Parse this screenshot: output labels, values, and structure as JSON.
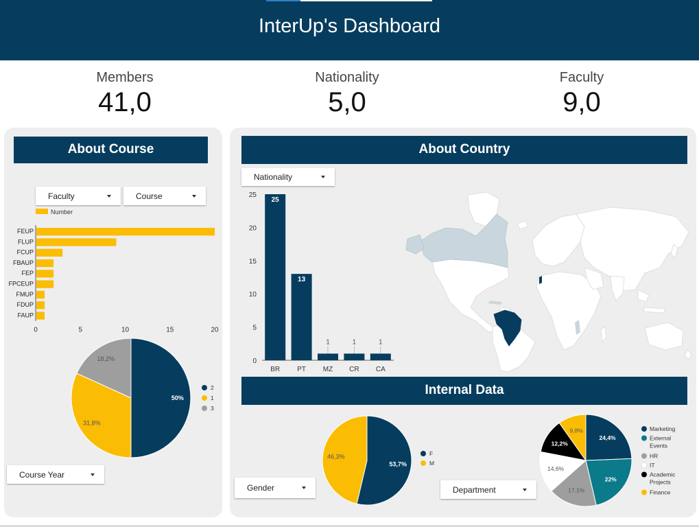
{
  "header": {
    "title": "InterUp's Dashboard"
  },
  "kpis": [
    {
      "label": "Members",
      "value": "41,0"
    },
    {
      "label": "Nationality",
      "value": "5,0"
    },
    {
      "label": "Faculty",
      "value": "9,0"
    }
  ],
  "course_panel": {
    "title": "About Course",
    "filters": {
      "faculty": "Faculty",
      "course": "Course",
      "course_year": "Course Year"
    }
  },
  "country_panel": {
    "title": "About Country",
    "filters": {
      "nationality": "Nationality"
    }
  },
  "internal_panel": {
    "title": "Internal Data",
    "filters": {
      "gender": "Gender",
      "department": "Department"
    }
  },
  "colors": {
    "navy": "#063d5e",
    "yellow": "#fbbc04",
    "teal": "#0b7a8a",
    "gray": "#9e9e9e",
    "black": "#000000",
    "white": "#ffffff",
    "map_highlight": "#063d5e",
    "map_light": "#c9d6de"
  },
  "chart_data": [
    {
      "id": "faculty_bar",
      "type": "bar",
      "orientation": "horizontal",
      "categories": [
        "FEUP",
        "FLUP",
        "FCUP",
        "FBAUP",
        "FEP",
        "FPCEUP",
        "FMUP",
        "FDUP",
        "FAUP"
      ],
      "series": [
        {
          "name": "Number",
          "values": [
            20,
            9,
            3,
            2,
            2,
            2,
            1,
            1,
            1
          ],
          "color": "#fbbc04"
        }
      ],
      "xlim": [
        0,
        20
      ],
      "xticks": [
        0,
        5,
        10,
        15,
        20
      ],
      "legend": "top-left"
    },
    {
      "id": "course_year_pie",
      "type": "pie",
      "slices": [
        {
          "label": "2",
          "value": 50,
          "text": "50%",
          "color": "#063d5e"
        },
        {
          "label": "1",
          "value": 31.8,
          "text": "31,8%",
          "color": "#fbbc04"
        },
        {
          "label": "3",
          "value": 18.2,
          "text": "18,2%",
          "color": "#9e9e9e"
        }
      ],
      "legend": "right"
    },
    {
      "id": "nationality_bar",
      "type": "bar",
      "categories": [
        "BR",
        "PT",
        "MZ",
        "CR",
        "CA"
      ],
      "series": [
        {
          "values": [
            25,
            13,
            1,
            1,
            1
          ],
          "color": "#063d5e"
        }
      ],
      "ylim": [
        0,
        25
      ],
      "yticks": [
        0,
        5,
        10,
        15,
        20,
        25
      ],
      "data_labels": true
    },
    {
      "id": "gender_pie",
      "type": "pie",
      "slices": [
        {
          "label": "F",
          "value": 53.7,
          "text": "53,7%",
          "color": "#063d5e"
        },
        {
          "label": "M",
          "value": 46.3,
          "text": "46,3%",
          "color": "#fbbc04"
        }
      ],
      "legend": "right"
    },
    {
      "id": "department_pie",
      "type": "pie",
      "slices": [
        {
          "label": "Marketing",
          "value": 24.4,
          "text": "24,4%",
          "color": "#063d5e"
        },
        {
          "label": "External Events",
          "value": 22,
          "text": "22%",
          "color": "#0b7a8a"
        },
        {
          "label": "HR",
          "value": 17.1,
          "text": "17,1%",
          "color": "#9e9e9e"
        },
        {
          "label": "IT",
          "value": 14.6,
          "text": "14,6%",
          "color": "#ffffff"
        },
        {
          "label": "Academic Projects",
          "value": 12.2,
          "text": "12,2%",
          "color": "#000000"
        },
        {
          "label": "Finance",
          "value": 9.8,
          "text": "9,8%",
          "color": "#fbbc04"
        }
      ],
      "legend": "right"
    }
  ]
}
